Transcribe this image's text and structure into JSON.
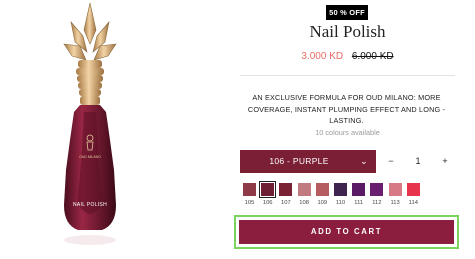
{
  "badge": "50 % OFF",
  "product": {
    "title": "Nail Polish",
    "price_current": "3.000 KD",
    "price_original": "6.000 KD",
    "description": "AN EXCLUSIVE FORMULA FOR OUD MILANO: MORE COVERAGE, INSTANT PLUMPING EFFECT AND LONG - LASTING.",
    "colours_available": "10 colours available",
    "bottle_brand": "OUD MILANO",
    "bottle_label": "NAIL POLISH"
  },
  "shade_select": {
    "value": "106 - PURPLE"
  },
  "quantity": {
    "minus": "−",
    "value": "1",
    "plus": "+"
  },
  "swatches": [
    {
      "code": "105",
      "color": "#8e3b47"
    },
    {
      "code": "106",
      "color": "#6e1f33",
      "selected": true
    },
    {
      "code": "107",
      "color": "#7a2233"
    },
    {
      "code": "108",
      "color": "#c07a80"
    },
    {
      "code": "109",
      "color": "#b45c5f"
    },
    {
      "code": "110",
      "color": "#3f2450"
    },
    {
      "code": "111",
      "color": "#5b1a66"
    },
    {
      "code": "112",
      "color": "#6a1e70"
    },
    {
      "code": "113",
      "color": "#d87a86"
    },
    {
      "code": "114",
      "color": "#e8334d"
    }
  ],
  "cta": {
    "add_to_cart": "ADD TO CART"
  },
  "colors": {
    "accent": "#8b1d3e",
    "select_bg": "#7a1f34",
    "sale_price": "#e96a63",
    "focus_outline": "#7bd35d"
  }
}
